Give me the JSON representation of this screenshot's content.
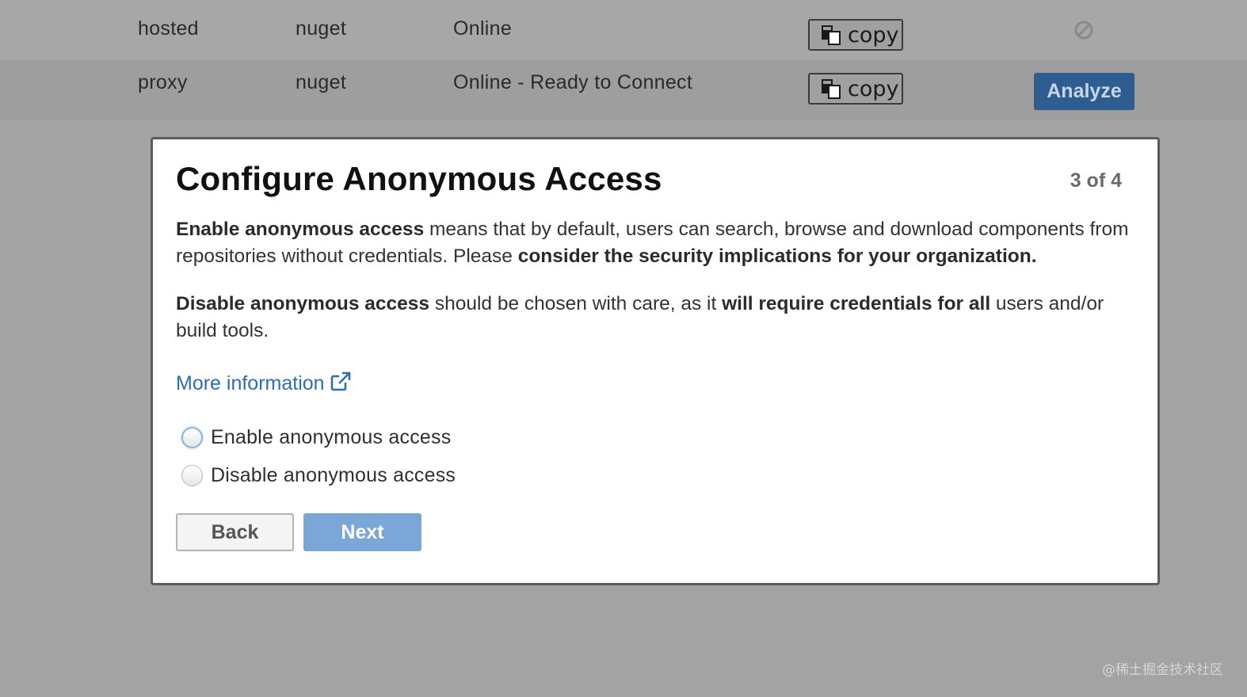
{
  "table": {
    "rows": [
      {
        "type": "hosted",
        "format": "nuget",
        "status": "Online",
        "copy_label": "copy",
        "action": "ban"
      },
      {
        "type": "proxy",
        "format": "nuget",
        "status": "Online - Ready to Connect",
        "copy_label": "copy",
        "action": "analyze",
        "action_label": "Analyze"
      }
    ]
  },
  "modal": {
    "title": "Configure Anonymous Access",
    "step": "3 of 4",
    "p1": {
      "bold1": "Enable anonymous access",
      "text1": " means that by default, users can search, browse and download components from repositories without credentials. Please ",
      "bold2": "consider the security implications for your organization."
    },
    "p2": {
      "bold1": "Disable anonymous access",
      "text1": " should be chosen with care, as it ",
      "bold2": "will require credentials for all",
      "text2": " users and/or build tools."
    },
    "more_info": "More information",
    "options": [
      {
        "label": "Enable anonymous access",
        "selected": false
      },
      {
        "label": "Disable anonymous access",
        "selected": false
      }
    ],
    "back_label": "Back",
    "next_label": "Next"
  },
  "watermark": "@稀土掘金技术社区",
  "icons": {
    "copy": "copy-icon",
    "ban": "ban-icon",
    "external_link": "external-link-icon"
  },
  "colors": {
    "analyze_bg": "#2e5d92",
    "next_bg": "#7aa6d8",
    "link": "#2e6db4"
  }
}
